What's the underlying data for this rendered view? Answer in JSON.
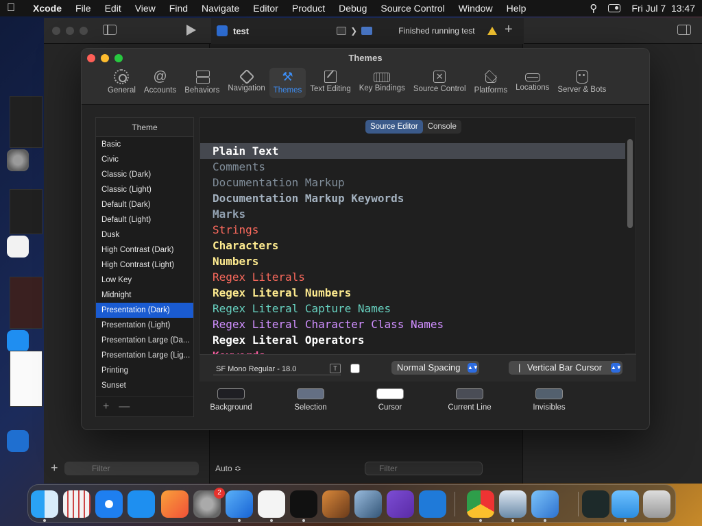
{
  "menubar": {
    "app_name": "Xcode",
    "items": [
      "File",
      "Edit",
      "View",
      "Find",
      "Navigate",
      "Editor",
      "Product",
      "Debug",
      "Source Control",
      "Window",
      "Help"
    ],
    "datetime": "Fri Jul 7  13:47"
  },
  "xcode": {
    "tab_title": "test",
    "status": "Finished running test",
    "filter_placeholder": "Filter",
    "filter_placeholder_2": "Filter",
    "auto_label": "Auto ≎"
  },
  "themes_window": {
    "title": "Themes",
    "tabs": [
      {
        "label": "General",
        "icon": "gear-icon"
      },
      {
        "label": "Accounts",
        "icon": "at-icon"
      },
      {
        "label": "Behaviors",
        "icon": "behaviors-icon"
      },
      {
        "label": "Navigation",
        "icon": "navigation-icon"
      },
      {
        "label": "Themes",
        "icon": "hammer-brush-icon",
        "active": true
      },
      {
        "label": "Text Editing",
        "icon": "edit-icon"
      },
      {
        "label": "Key Bindings",
        "icon": "keyboard-icon"
      },
      {
        "label": "Source Control",
        "icon": "source-control-icon"
      },
      {
        "label": "Platforms",
        "icon": "layers-icon"
      },
      {
        "label": "Locations",
        "icon": "drive-icon"
      },
      {
        "label": "Server & Bots",
        "icon": "robot-icon"
      }
    ],
    "theme_list_header": "Theme",
    "themes": [
      "Basic",
      "Civic",
      "Classic (Dark)",
      "Classic (Light)",
      "Default (Dark)",
      "Default (Light)",
      "Dusk",
      "High Contrast (Dark)",
      "High Contrast (Light)",
      "Low Key",
      "Midnight",
      "Presentation (Dark)",
      "Presentation (Light)",
      "Presentation Large (Da...",
      "Presentation Large (Lig...",
      "Printing",
      "Sunset"
    ],
    "selected_theme": "Presentation (Dark)",
    "list_add": "+",
    "list_remove": "—",
    "segments": [
      "Source Editor",
      "Console"
    ],
    "active_segment": "Source Editor",
    "syntax_items": [
      {
        "label": "Plain Text",
        "color": "#ffffff",
        "bold": true,
        "highlighted": true
      },
      {
        "label": "Comments",
        "color": "#7f8c98",
        "bold": false
      },
      {
        "label": "Documentation Markup",
        "color": "#7f8c98",
        "bold": false
      },
      {
        "label": "Documentation Markup Keywords",
        "color": "#a3b1bf",
        "bold": true
      },
      {
        "label": "Marks",
        "color": "#92a1b1",
        "bold": true
      },
      {
        "label": "Strings",
        "color": "#fc6a5d",
        "bold": false
      },
      {
        "label": "Characters",
        "color": "#fdea8f",
        "bold": true
      },
      {
        "label": "Numbers",
        "color": "#fdea8f",
        "bold": true
      },
      {
        "label": "Regex Literals",
        "color": "#fc6a5d",
        "bold": false
      },
      {
        "label": "Regex Literal Numbers",
        "color": "#fdea8f",
        "bold": true
      },
      {
        "label": "Regex Literal Capture Names",
        "color": "#67d1c0",
        "bold": false
      },
      {
        "label": "Regex Literal Character Class Names",
        "color": "#d08fff",
        "bold": false
      },
      {
        "label": "Regex Literal Operators",
        "color": "#ffffff",
        "bold": true
      },
      {
        "label": "Keywords",
        "color": "#fc5fa3",
        "bold": true
      }
    ],
    "font_name": "SF Mono Regular - 18.0",
    "font_button": "T",
    "spacing_option": "Normal Spacing",
    "cursor_option": "Vertical Bar Cursor",
    "cursor_prefix": "|",
    "swatches": [
      {
        "label": "Background",
        "color": "#1f1f24"
      },
      {
        "label": "Selection",
        "color": "#646f83"
      },
      {
        "label": "Cursor",
        "color": "#ffffff"
      },
      {
        "label": "Current Line",
        "color": "#4a4d56"
      },
      {
        "label": "Invisibles",
        "color": "#53606e"
      }
    ]
  },
  "dock": {
    "apps": [
      "Finder",
      "Launchpad",
      "Safari",
      "App Store",
      "Swift Playgrounds",
      "System Settings",
      "Xcode",
      "TextEdit",
      "Terminal",
      "Instruments",
      "Create ML",
      "Visual Studio",
      "Visual Studio Code",
      "Google Chrome",
      "Preview",
      "Xcode Beta",
      "Activity Monitor",
      "Downloads",
      "Trash"
    ],
    "settings_badge": "2"
  }
}
